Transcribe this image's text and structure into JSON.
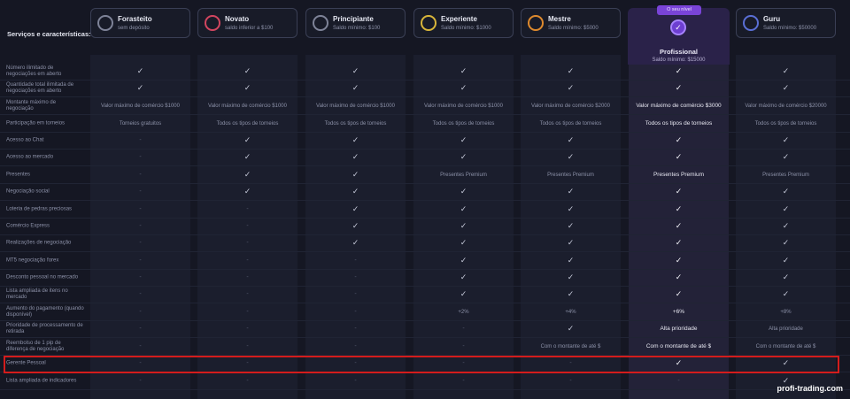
{
  "services_title": "Serviços e características:",
  "tiers": [
    {
      "name": "Forasteito",
      "sub": "sem depósito",
      "ring": "#7e8398"
    },
    {
      "name": "Novato",
      "sub": "saldo inferior a $100",
      "ring": "#d2455f"
    },
    {
      "name": "Principiante",
      "sub": "Saldo mínimo: $100",
      "ring": "#7e8398"
    },
    {
      "name": "Experiente",
      "sub": "Saldo mínimo: $1000",
      "ring": "#d8b53a"
    },
    {
      "name": "Mestre",
      "sub": "Saldo mínimo: $5000",
      "ring": "#de8a2e"
    },
    {
      "name": "Profissional",
      "sub": "Saldo mínimo: $15000",
      "badge": "O seu nível",
      "ring": "#a784ff"
    },
    {
      "name": "Guru",
      "sub": "Saldo mínimo: $50000",
      "ring": "#5a6fd6"
    }
  ],
  "rows": [
    {
      "label": "Número ilimitado de negociações em aberto",
      "cells": [
        "✓",
        "✓",
        "✓",
        "✓",
        "✓",
        "✓",
        "✓"
      ]
    },
    {
      "label": "Quantidade total ilimitada de negociações em aberto",
      "cells": [
        "✓",
        "✓",
        "✓",
        "✓",
        "✓",
        "✓",
        "✓"
      ]
    },
    {
      "label": "Montante máximo de negociação",
      "cells": [
        "Valor máximo de comércio $1000",
        "Valor máximo de comércio $1000",
        "Valor máximo de comércio $1000",
        "Valor máximo de comércio $1000",
        "Valor máximo de comércio $2000",
        "Valor máximo de comércio $3000",
        "Valor máximo de comércio $20000"
      ]
    },
    {
      "label": "Participação em torneios",
      "cells": [
        "Torneios gratuitos",
        "Todos os tipos de torneios",
        "Todos os tipos de torneios",
        "Todos os tipos de torneios",
        "Todos os tipos de torneios",
        "Todos os tipos de torneios",
        "Todos os tipos de torneios"
      ]
    },
    {
      "label": "Acesso ao Chat",
      "cells": [
        "-",
        "✓",
        "✓",
        "✓",
        "✓",
        "✓",
        "✓"
      ]
    },
    {
      "label": "Acesso ao mercado",
      "cells": [
        "-",
        "✓",
        "✓",
        "✓",
        "✓",
        "✓",
        "✓"
      ]
    },
    {
      "label": "Presentes",
      "cells": [
        "-",
        "✓",
        "✓",
        "Presentes Premium",
        "Presentes Premium",
        "Presentes Premium",
        "Presentes Premium"
      ]
    },
    {
      "label": "Negociação social",
      "cells": [
        "-",
        "✓",
        "✓",
        "✓",
        "✓",
        "✓",
        "✓"
      ]
    },
    {
      "label": "Loteria de pedras preciosas",
      "cells": [
        "-",
        "-",
        "✓",
        "✓",
        "✓",
        "✓",
        "✓"
      ]
    },
    {
      "label": "Comércio Express",
      "cells": [
        "-",
        "-",
        "✓",
        "✓",
        "✓",
        "✓",
        "✓"
      ]
    },
    {
      "label": "Realizações de negociação",
      "cells": [
        "-",
        "-",
        "✓",
        "✓",
        "✓",
        "✓",
        "✓"
      ]
    },
    {
      "label": "MT5 negociação forex",
      "cells": [
        "-",
        "-",
        "-",
        "✓",
        "✓",
        "✓",
        "✓"
      ]
    },
    {
      "label": "Desconto pessoal no mercado",
      "cells": [
        "-",
        "-",
        "-",
        "✓",
        "✓",
        "✓",
        "✓"
      ]
    },
    {
      "label": "Lista ampliada de itens no mercado",
      "cells": [
        "-",
        "-",
        "-",
        "✓",
        "✓",
        "✓",
        "✓"
      ]
    },
    {
      "label": "Aumento do pagamento (quando disponível)",
      "cells": [
        "-",
        "-",
        "-",
        "+2%",
        "+4%",
        "+6%",
        "+8%"
      ]
    },
    {
      "label": "Prioridade de processamento de retirada",
      "cells": [
        "-",
        "-",
        "-",
        "-",
        "✓",
        "Alta prioridade",
        "Alta prioridade"
      ]
    },
    {
      "label": "Reembolso de 1 pip de diferença de negociação",
      "cells": [
        "-",
        "-",
        "-",
        "-",
        "Com o montante de até $",
        "Com o montante de até $",
        "Com o montante de até $"
      ]
    },
    {
      "label": "Gerente Pessoal",
      "cells": [
        "-",
        "-",
        "-",
        "-",
        "-",
        "✓",
        "✓"
      ]
    },
    {
      "label": "Lista ampliada de indicadores",
      "cells": [
        "-",
        "-",
        "-",
        "-",
        "-",
        "-",
        "✓"
      ]
    }
  ],
  "watermark": "profi-trading.com"
}
